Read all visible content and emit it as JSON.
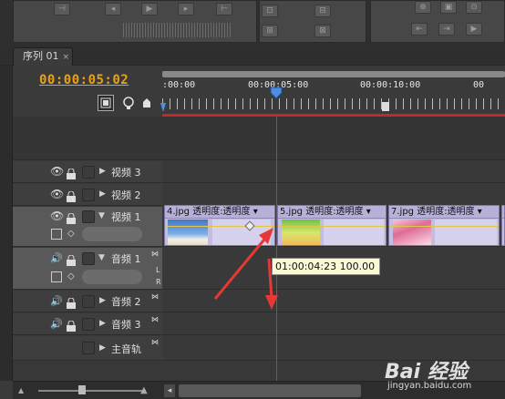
{
  "tab": {
    "title": "序列 01",
    "close": "×"
  },
  "timecode": "00:00:05:02",
  "ruler": {
    "labels": [
      ":00:00",
      "00:00:05:00",
      "00:00:10:00",
      "00"
    ]
  },
  "tracks": {
    "video3": "视频 3",
    "video2": "视频 2",
    "video1": "视频 1",
    "audio1": "音频 1",
    "audio2": "音频 2",
    "audio3": "音频 3",
    "master": "主音轨"
  },
  "audio_side_labels": [
    "L",
    "R"
  ],
  "clips": [
    {
      "title": "4.jpg  透明度:透明度 ▾"
    },
    {
      "title": "5.jpg  透明度:透明度 ▾"
    },
    {
      "title": "7.jpg  透明度:透明度 ▾"
    },
    {
      "title": "8"
    }
  ],
  "tooltip": "01:00:04:23  100.00",
  "watermark": {
    "brand": "Bai 经验",
    "site": "jingyan.baidu.com"
  },
  "colors": {
    "timecode": "#e6a21a",
    "playhead": "#d23030",
    "clip": "#c3bde0",
    "arrow": "#e53935"
  }
}
